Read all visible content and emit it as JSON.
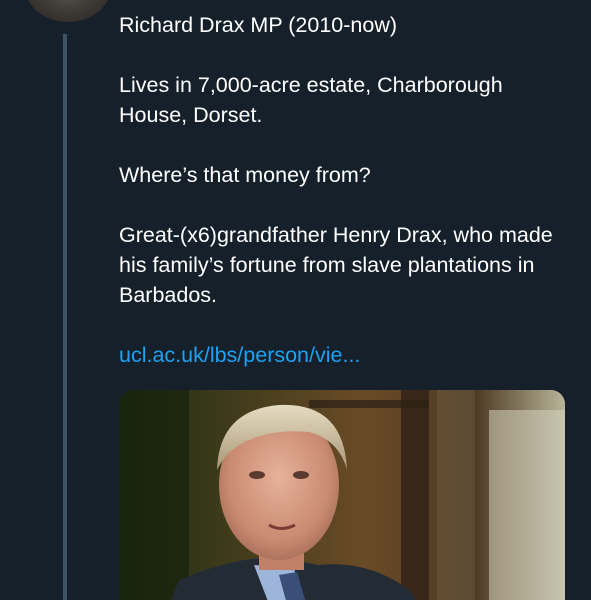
{
  "tweet": {
    "paragraphs": [
      "Richard Drax MP (2010-now)",
      "Lives in 7,000-acre estate, Charborough House, Dorset.",
      "Where’s that money from?",
      "Great-(x6)grandfather Henry Drax, who made his family’s fortune from slave plantations in Barbados."
    ],
    "link_text": "ucl.ac.uk/lbs/person/vie..."
  },
  "colors": {
    "background": "#15202b",
    "text": "#ffffff",
    "link": "#1da1f2",
    "thread_line": "#3d5466"
  },
  "icons": {
    "avatar": "user-avatar-photo",
    "media": "link-preview-photo"
  }
}
